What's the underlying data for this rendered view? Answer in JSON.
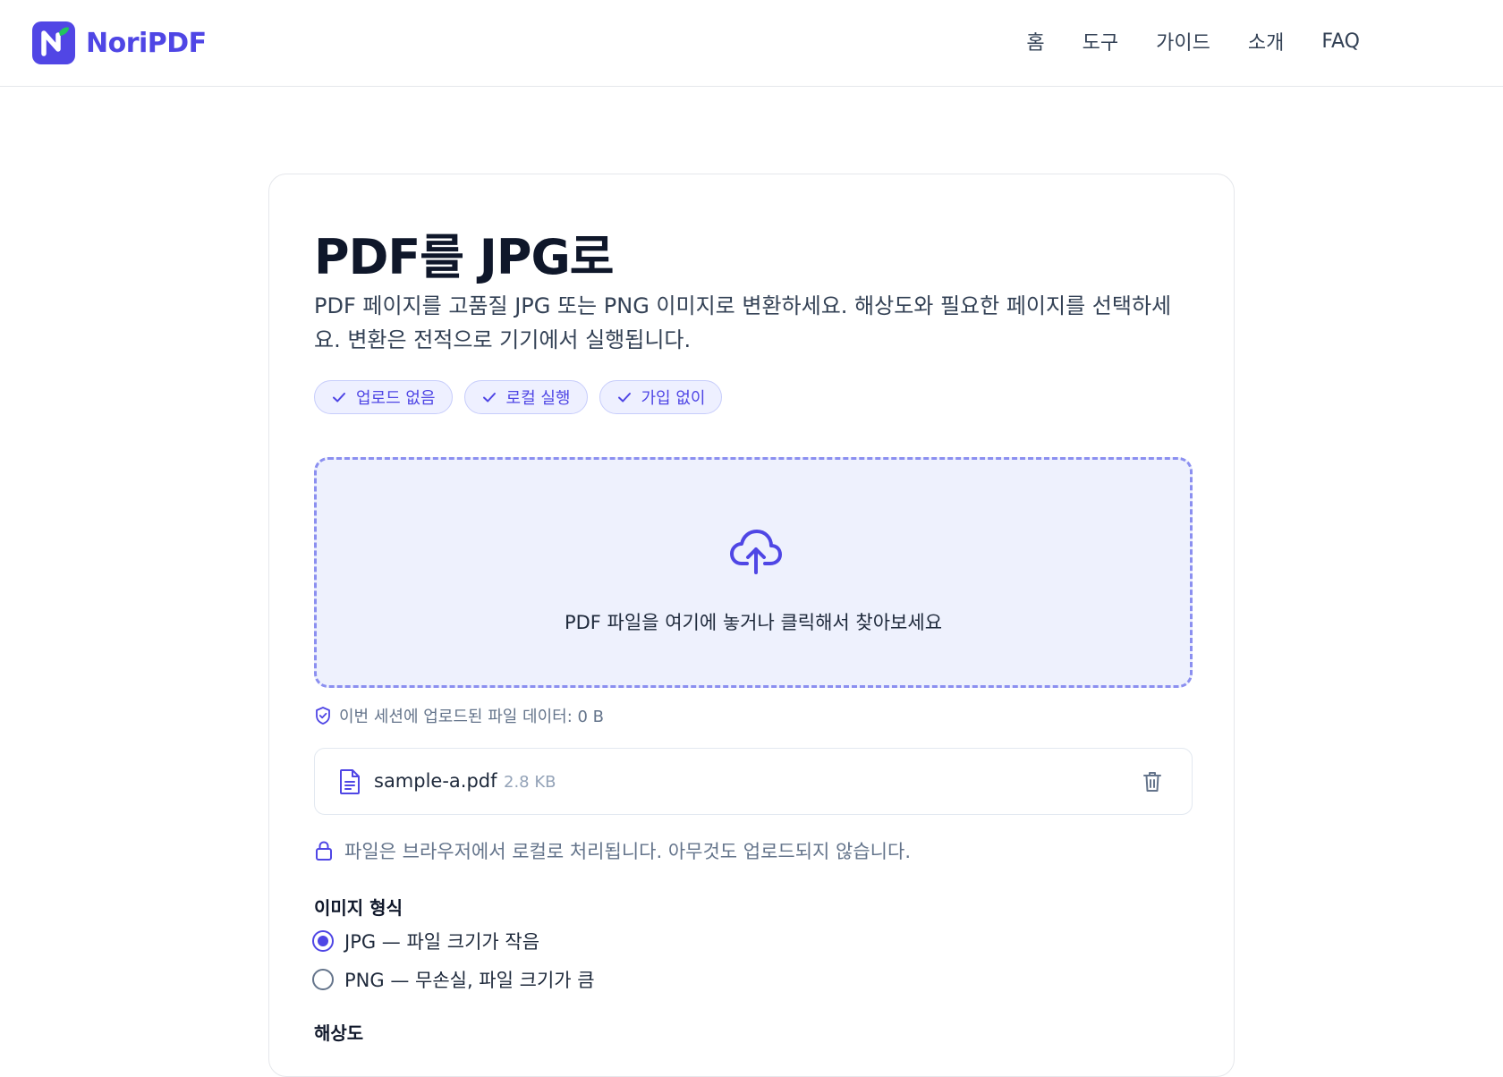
{
  "header": {
    "logo_text": "NoriPDF",
    "nav": [
      "홈",
      "도구",
      "가이드",
      "소개",
      "FAQ"
    ]
  },
  "main": {
    "title": "PDF를 JPG로",
    "description": "PDF 페이지를 고품질 JPG 또는 PNG 이미지로 변환하세요. 해상도와 필요한 페이지를 선택하세요. 변환은 전적으로 기기에서 실행됩니다.",
    "badges": [
      "업로드 없음",
      "로컬 실행",
      "가입 없이"
    ],
    "dropzone_text": "PDF 파일을 여기에 놓거나 클릭해서 찾아보세요",
    "session_text": "이번 세션에 업로드된 파일 데이터: 0 B",
    "file": {
      "name": "sample-a.pdf",
      "size": "2.8 KB"
    },
    "local_note": "파일은 브라우저에서 로컬로 처리됩니다. 아무것도 업로드되지 않습니다.",
    "format_label": "이미지 형식",
    "format_options": [
      {
        "label": "JPG — 파일 크기가 작음",
        "selected": true
      },
      {
        "label": "PNG — 무손실, 파일 크기가 큼",
        "selected": false
      }
    ],
    "resolution_label": "해상도"
  },
  "colors": {
    "accent": "#4f46e5",
    "accent_light": "#eef1fd",
    "leaf": "#22c55e"
  }
}
